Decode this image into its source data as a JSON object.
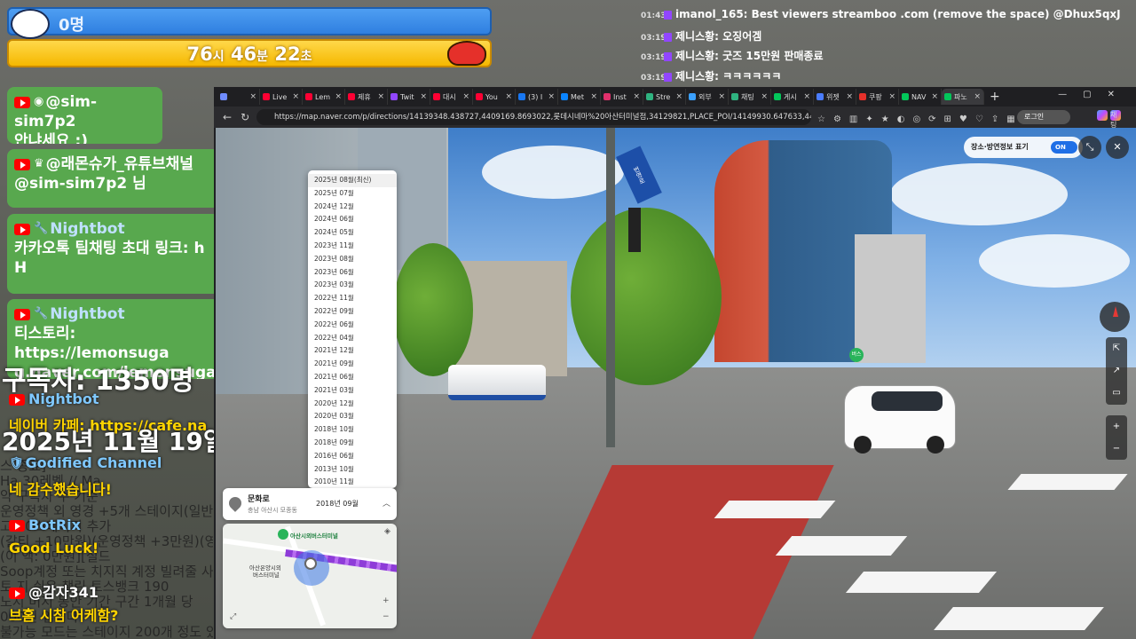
{
  "overlay": {
    "viewer_bar": {
      "label": "0명"
    },
    "timer": {
      "hours": "76",
      "hours_unit": "시",
      "minutes": "46",
      "minutes_unit": "분",
      "seconds": "22",
      "seconds_unit": "초"
    }
  },
  "left_chat": [
    {
      "name": "@sim-sim7p2",
      "message": "안냐세요 :)"
    },
    {
      "name": "@래몬슈가_유튜브채널",
      "message": "@sim-sim7p2 님"
    },
    {
      "name": "Nightbot",
      "message": "카카오톡 팀채팅 초대 링크: h",
      "message2": "H"
    },
    {
      "name": "Nightbot",
      "message": "티스토리: https://lemonsuga",
      "message2": "g.naver.com/lemonsugar18"
    }
  ],
  "background_overlay": {
    "subscribers": "구독자: 1350명",
    "date": "2025년 11월 19일",
    "nightbot_name": "Nightbot",
    "nightbot_msg": "네이버 카페: https://cafe.na",
    "godified_name": "Godified Channel",
    "godified_msg": "네 감수했습니다!",
    "botrix_name": "BotRix",
    "botrix_msg": "Good Luck!",
    "user_name": "@감자341",
    "user_msg": "브홈 시참 어케함?",
    "bg_lines": [
      "스 종료]",
      "Ha              30레벨 // Ma",
      "약                 구독자 수 기준",
      "운영정책 외 영경 +5개 스테이지(일반",
      "고          20스테이지 추가",
      "(갈티 +10만원)(운영정책 +3만원)(영경",
      "(이                    액: 0만원][실드",
      "Soop계정 또는 치지직 계정 빌려줄 사",
      "토    지 쉬운 챌린 토스뱅크 190",
      "노지 머지 동안 기간 구간 1개월 당",
      "                000원 입니다!",
      "불가능 모드는 스테이지 200개 정도 있"
    ]
  },
  "top_right_chat": [
    {
      "time": "01:43",
      "text": "imanol_165: Best viewers streamboo .com (remove the space) @Dhux5qxJ"
    },
    {
      "time": "03:19",
      "text": "제니스황: 오징어겜"
    },
    {
      "time": "03:19",
      "text": "제니스황: 굿즈 15만원 판매종료"
    },
    {
      "time": "03:19",
      "text": "제니스황: ㅋㅋㅋㅋㅋㅋ"
    }
  ],
  "browser": {
    "tabs": [
      {
        "label": "",
        "color": "#6f8cff"
      },
      {
        "label": "Live",
        "color": "#ff0033"
      },
      {
        "label": "Lem",
        "color": "#ff0033"
      },
      {
        "label": "제휴",
        "color": "#ff0033"
      },
      {
        "label": "Twit",
        "color": "#9146ff"
      },
      {
        "label": "대시",
        "color": "#ff0033"
      },
      {
        "label": "You",
        "color": "#ff0033"
      },
      {
        "label": "(3) I",
        "color": "#1877f2"
      },
      {
        "label": "Met",
        "color": "#0a84ff"
      },
      {
        "label": "Inst",
        "color": "#e1306c"
      },
      {
        "label": "Stre",
        "color": "#2fb380"
      },
      {
        "label": "외부",
        "color": "#3aa0ff"
      },
      {
        "label": "채팅",
        "color": "#2fb380"
      },
      {
        "label": "게시",
        "color": "#03c75a"
      },
      {
        "label": "위젯",
        "color": "#4a7cff"
      },
      {
        "label": "쿠팡",
        "color": "#e5302a"
      },
      {
        "label": "NAV",
        "color": "#03c75a"
      },
      {
        "label": "파노",
        "color": "#03c75a"
      }
    ],
    "new_tab": "+",
    "url": "https://map.naver.com/p/directions/14139348.438727,4409169.8693022,롯데시네마%20아산터미널점,34129821,PLACE_POI/14149930.647633,4414626.0...",
    "login_label": "로그인",
    "copilot_label": "채팅"
  },
  "streetview": {
    "toggle_label": "장소·방연정보 표기",
    "toggle_state": "ON",
    "dates": [
      "2025년 08월(최신)",
      "2025년 07월",
      "2024년 12월",
      "2024년 06월",
      "2024년 05월",
      "2023년 11월",
      "2023년 08월",
      "2023년 06월",
      "2023년 03월",
      "2022년 11월",
      "2022년 09월",
      "2022년 06월",
      "2022년 04월",
      "2021년 12월",
      "2021년 09월",
      "2021년 06월",
      "2021년 03월",
      "2020년 12월",
      "2020년 03월",
      "2018년 10월",
      "2018년 09월",
      "2016년 06월",
      "2013년 10월",
      "2010년 11월"
    ],
    "place_name": "문화로",
    "place_addr": "충남 아산시 모종동",
    "selected_date": "2018년 09월",
    "minimap_label": "아산시외버스터미널",
    "minimap_label2": "아산온양시외",
    "minimap_label3": "버스터미널",
    "sign_text": "번영로",
    "bus_label": "버스"
  }
}
